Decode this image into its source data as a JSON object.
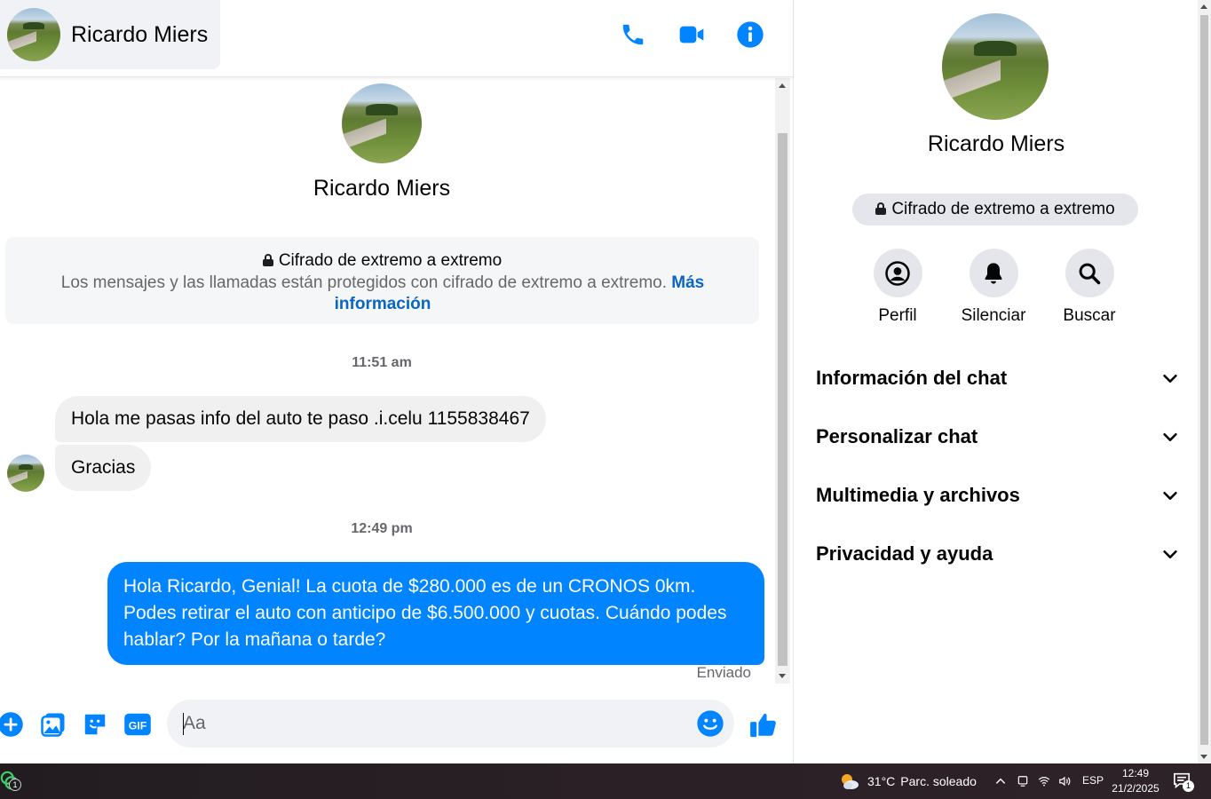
{
  "contact": {
    "name": "Ricardo Miers"
  },
  "header": {
    "icons": [
      "phone-icon",
      "video-camera-icon",
      "info-icon"
    ],
    "accent_color": "#0084ff"
  },
  "intro": {
    "name": "Ricardo Miers",
    "e2e_title": "Cifrado de extremo a extremo",
    "e2e_text": "Los mensajes y las llamadas están protegidos con cifrado de extremo a extremo.",
    "e2e_link": "Más información"
  },
  "messages": [
    {
      "type": "timestamp",
      "text": "11:51 am"
    },
    {
      "type": "incoming",
      "text": "Hola me pasas info del auto  te paso .i.celu 1155838467"
    },
    {
      "type": "incoming",
      "text": "Gracias"
    },
    {
      "type": "timestamp",
      "text": "12:49 pm"
    },
    {
      "type": "outgoing",
      "text": "Hola Ricardo, Genial! La cuota de $280.000 es de un CRONOS 0km. Podes retirar el auto con anticipo de $6.500.000 y cuotas. Cuándo podes hablar? Por la mañana o tarde?"
    }
  ],
  "message_status": "Enviado",
  "composer": {
    "placeholder": "Aa",
    "gif_label": "GIF",
    "icons": [
      "plus-icon",
      "image-icon",
      "sticker-icon",
      "gif-icon",
      "emoji-icon",
      "thumbs-up-icon"
    ]
  },
  "info_panel": {
    "name": "Ricardo Miers",
    "e2e_badge": "Cifrado de extremo a extremo",
    "actions": [
      {
        "label": "Perfil",
        "icon": "profile-icon"
      },
      {
        "label": "Silenciar",
        "icon": "bell-icon"
      },
      {
        "label": "Buscar",
        "icon": "search-icon"
      }
    ],
    "sections": [
      {
        "label": "Información del chat"
      },
      {
        "label": "Personalizar chat"
      },
      {
        "label": "Multimedia y archivos"
      },
      {
        "label": "Privacidad y ayuda"
      }
    ]
  },
  "taskbar": {
    "app_badge": "1",
    "temperature": "31°C",
    "weather": "Parc. soleado",
    "language": "ESP",
    "time": "12:49",
    "date": "21/2/2025",
    "notification_count": "1"
  }
}
